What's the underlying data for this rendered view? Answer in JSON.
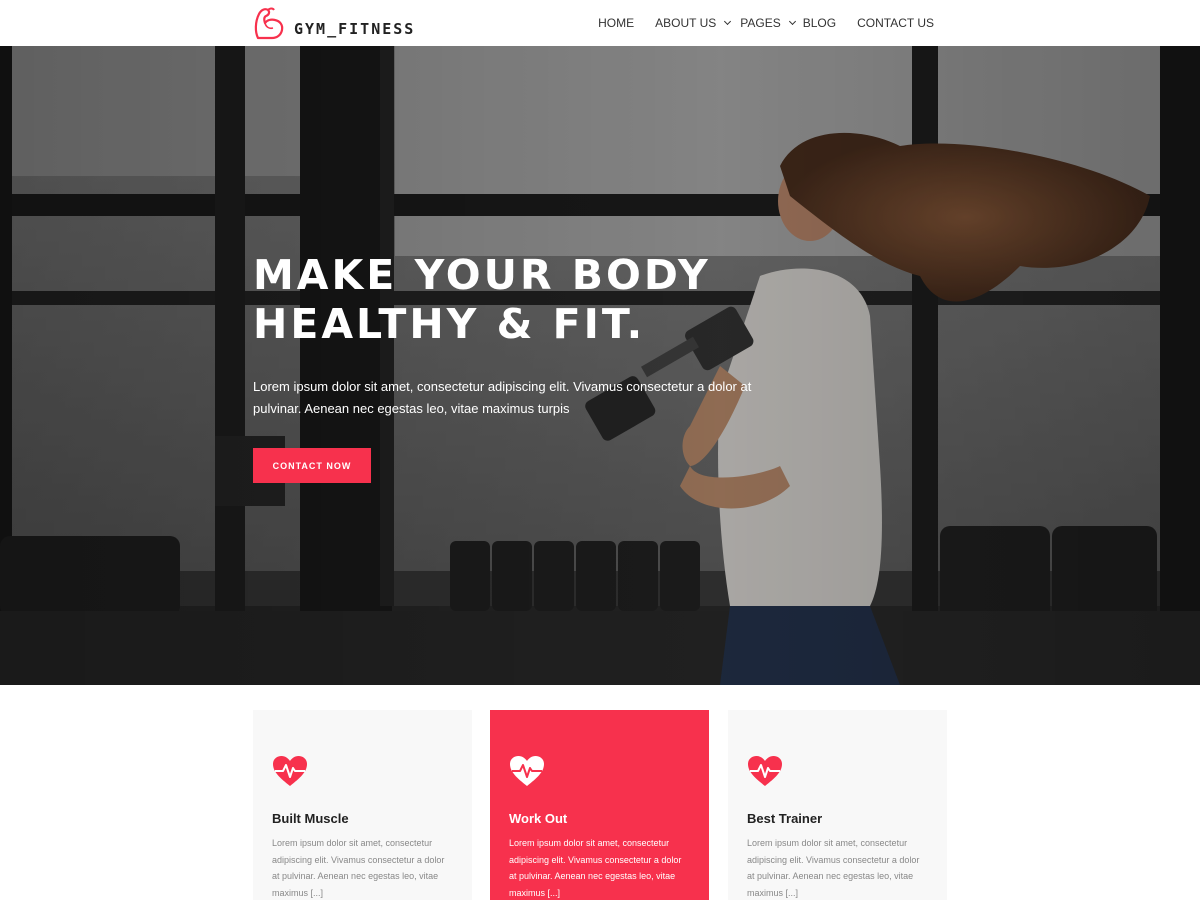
{
  "brand": {
    "name": "GYM_FITNESS",
    "accent_color": "#f7314d"
  },
  "nav": {
    "items": [
      {
        "label": "HOME",
        "dropdown": false
      },
      {
        "label": "ABOUT US",
        "dropdown": true
      },
      {
        "label": "PAGES",
        "dropdown": true
      },
      {
        "label": "BLOG",
        "dropdown": false
      },
      {
        "label": "CONTACT US",
        "dropdown": false
      }
    ]
  },
  "hero": {
    "title_line1": "MAKE YOUR BODY",
    "title_line2": "HEALTHY & FIT.",
    "text": "Lorem ipsum dolor sit amet, consectetur adipiscing elit. Vivamus consectetur a dolor at pulvinar. Aenean nec egestas leo, vitae maximus turpis",
    "button_label": "CONTACT NOW"
  },
  "features": [
    {
      "title": "Built Muscle",
      "icon": "heart-pulse-icon",
      "text": "Lorem ipsum dolor sit amet, consectetur adipiscing elit. Vivamus consectetur a dolor at pulvinar. Aenean nec egestas leo, vitae maximus [...]",
      "highlighted": false
    },
    {
      "title": "Work Out",
      "icon": "heart-pulse-icon",
      "text": "Lorem ipsum dolor sit amet, consectetur adipiscing elit. Vivamus consectetur a dolor at pulvinar. Aenean nec egestas leo, vitae maximus [...]",
      "highlighted": true
    },
    {
      "title": "Best Trainer",
      "icon": "heart-pulse-icon",
      "text": "Lorem ipsum dolor sit amet, consectetur adipiscing elit. Vivamus consectetur a dolor at pulvinar. Aenean nec egestas leo, vitae maximus [...]",
      "highlighted": false
    }
  ]
}
